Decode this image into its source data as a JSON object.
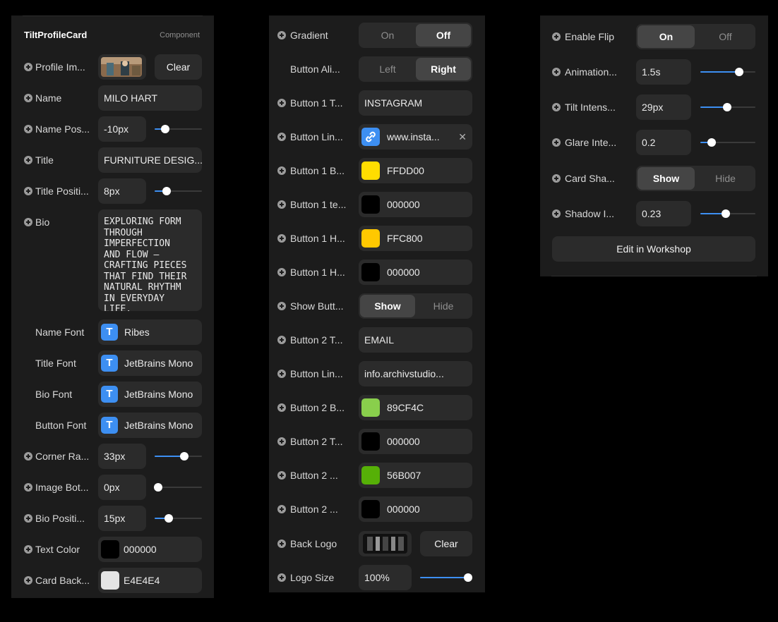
{
  "panel1": {
    "title": "TiltProfileCard",
    "tag": "Component",
    "profile_image": {
      "label": "Profile Im...",
      "clear": "Clear"
    },
    "name": {
      "label": "Name",
      "value": "MILO HART"
    },
    "name_position": {
      "label": "Name Pos...",
      "value": "-10px",
      "level": 0.22
    },
    "title_field": {
      "label": "Title",
      "value": "FURNITURE DESIG..."
    },
    "title_position": {
      "label": "Title Positi...",
      "value": "8px",
      "level": 0.25
    },
    "bio": {
      "label": "Bio",
      "lines": [
        "EXPLORING FORM",
        "THROUGH",
        "IMPERFECTION",
        "AND FLOW —",
        "CRAFTING PIECES",
        "THAT FIND THEIR",
        "NATURAL RHYTHM",
        "IN EVERYDAY LIFE."
      ]
    },
    "name_font": {
      "label": "Name Font",
      "value": "Ribes"
    },
    "title_font": {
      "label": "Title Font",
      "value": "JetBrains Mono"
    },
    "bio_font": {
      "label": "Bio Font",
      "value": "JetBrains Mono"
    },
    "button_font": {
      "label": "Button Font",
      "value": "JetBrains Mono"
    },
    "corner_radius": {
      "label": "Corner Ra...",
      "value": "33px",
      "level": 0.63
    },
    "image_bottom": {
      "label": "Image Bot...",
      "value": "0px",
      "level": 0.0
    },
    "bio_position": {
      "label": "Bio Positi...",
      "value": "15px",
      "level": 0.3
    },
    "text_color": {
      "label": "Text Color",
      "value": "000000",
      "color": "#000000"
    },
    "card_background": {
      "label": "Card Back...",
      "value": "E4E4E4",
      "color": "#E4E4E4"
    }
  },
  "panel2": {
    "gradient": {
      "label": "Gradient",
      "on": "On",
      "off": "Off"
    },
    "button_align": {
      "label": "Button Ali...",
      "left": "Left",
      "right": "Right"
    },
    "button1_text": {
      "label": "Button 1 T...",
      "value": "INSTAGRAM"
    },
    "button1_link": {
      "label": "Button Lin...",
      "value": "www.insta..."
    },
    "button1_bg": {
      "label": "Button 1 B...",
      "value": "FFDD00",
      "color": "#FFDD00"
    },
    "button1_text_color": {
      "label": "Button 1 te...",
      "value": "000000",
      "color": "#000000"
    },
    "button1_hover": {
      "label": "Button 1 H...",
      "value": "FFC800",
      "color": "#FFC800"
    },
    "button1_hover_text": {
      "label": "Button 1 H...",
      "value": "000000",
      "color": "#000000"
    },
    "show_buttons": {
      "label": "Show Butt...",
      "show": "Show",
      "hide": "Hide"
    },
    "button2_text": {
      "label": "Button 2 T...",
      "value": "EMAIL"
    },
    "button2_link": {
      "label": "Button Lin...",
      "value": "info.archivstudio..."
    },
    "button2_bg": {
      "label": "Button 2 B...",
      "value": "89CF4C",
      "color": "#89CF4C"
    },
    "button2_text_color": {
      "label": "Button 2 T...",
      "value": "000000",
      "color": "#000000"
    },
    "button2_hover": {
      "label": "Button 2 ...",
      "value": "56B007",
      "color": "#56B007"
    },
    "button2_hover_text": {
      "label": "Button 2 ...",
      "value": "000000",
      "color": "#000000"
    },
    "back_logo": {
      "label": "Back Logo",
      "clear": "Clear"
    },
    "logo_size": {
      "label": "Logo Size",
      "value": "100%",
      "level": 1.0
    }
  },
  "panel3": {
    "enable_flip": {
      "label": "Enable Flip",
      "on": "On",
      "off": "Off"
    },
    "animation": {
      "label": "Animation...",
      "value": "1.5s",
      "level": 0.7
    },
    "tilt_intensity": {
      "label": "Tilt Intens...",
      "value": "29px",
      "level": 0.49
    },
    "glare_intensity": {
      "label": "Glare Inte...",
      "value": "0.2",
      "level": 0.2
    },
    "card_shadow": {
      "label": "Card Sha...",
      "show": "Show",
      "hide": "Hide"
    },
    "shadow_intensity": {
      "label": "Shadow I...",
      "value": "0.23",
      "level": 0.46
    },
    "edit_button": "Edit in Workshop"
  },
  "colors": {
    "accent": "#3d8ff2",
    "panel": "#1c1c1c",
    "field": "#2b2b2b"
  },
  "icons": {
    "add": "plus-circle-icon",
    "font": "font-t-icon",
    "link": "link-icon",
    "clear": "close-icon"
  }
}
